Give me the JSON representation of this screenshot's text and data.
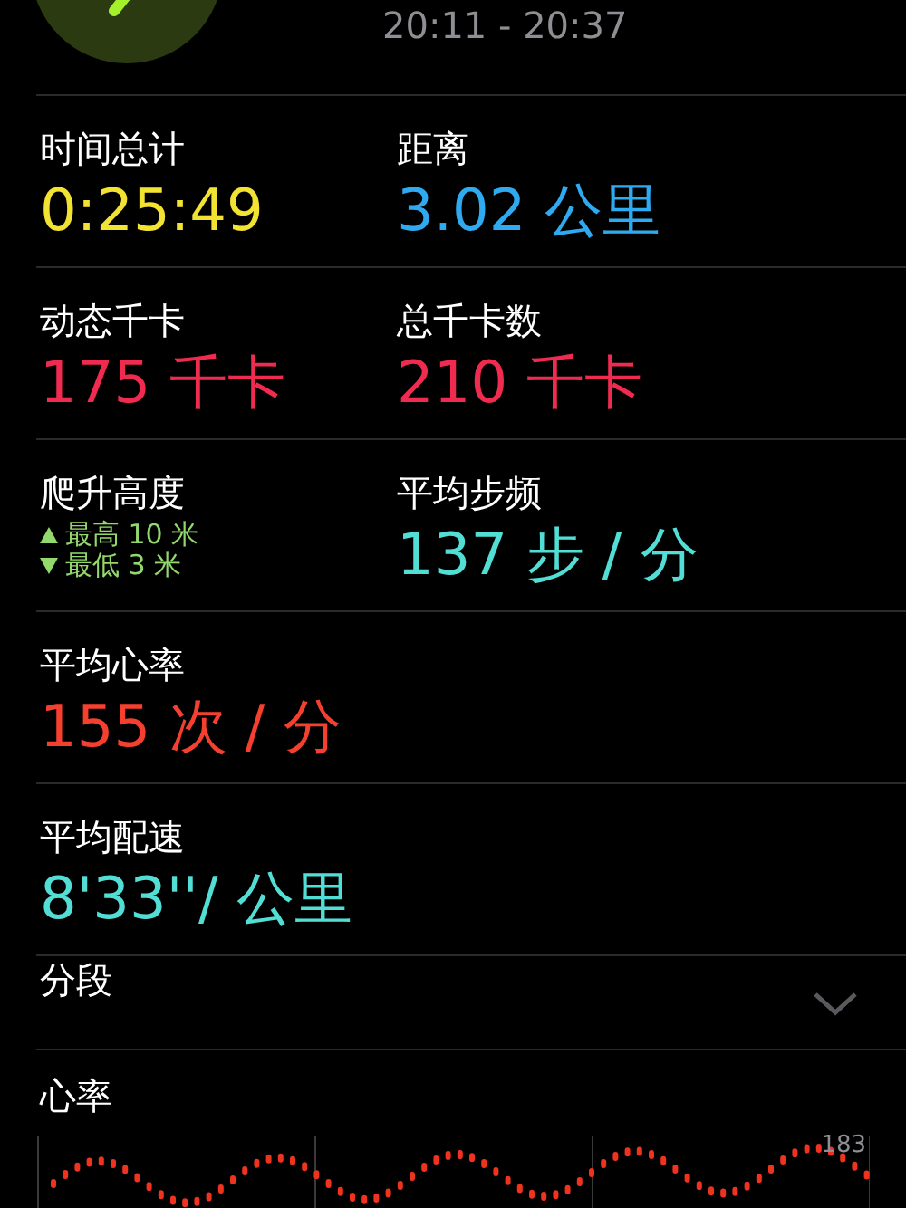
{
  "header": {
    "time_range": "20:11 - 20:37"
  },
  "rows": [
    {
      "cells": [
        {
          "kind": "value",
          "label": "时间总计",
          "value": "0:25:49",
          "color": "#f2e232"
        },
        {
          "kind": "value",
          "label": "距离",
          "value": "3.02 公里",
          "color": "#2fa9f0"
        }
      ]
    },
    {
      "cells": [
        {
          "kind": "value",
          "label": "动态千卡",
          "value": "175 千卡",
          "color": "#f02b50"
        },
        {
          "kind": "value",
          "label": "总千卡数",
          "value": "210 千卡",
          "color": "#f02b50"
        }
      ]
    },
    {
      "cells": [
        {
          "kind": "elevation",
          "label": "爬升高度",
          "high": "最高 10 米",
          "low": "最低 3 米",
          "color": "#93d86c"
        },
        {
          "kind": "value",
          "label": "平均步频",
          "value": "137 步 / 分",
          "color": "#52ded5"
        }
      ]
    },
    {
      "cells": [
        {
          "kind": "value",
          "label": "平均心率",
          "value": "155 次 / 分",
          "color": "#f5402f"
        }
      ]
    },
    {
      "cells": [
        {
          "kind": "value",
          "label": "平均配速",
          "value": "8'33''/ 公里",
          "color": "#52ded5"
        }
      ]
    }
  ],
  "segments": {
    "label": "分段",
    "expanded": false
  },
  "heart_rate": {
    "title": "心率",
    "max_label": "183"
  }
}
